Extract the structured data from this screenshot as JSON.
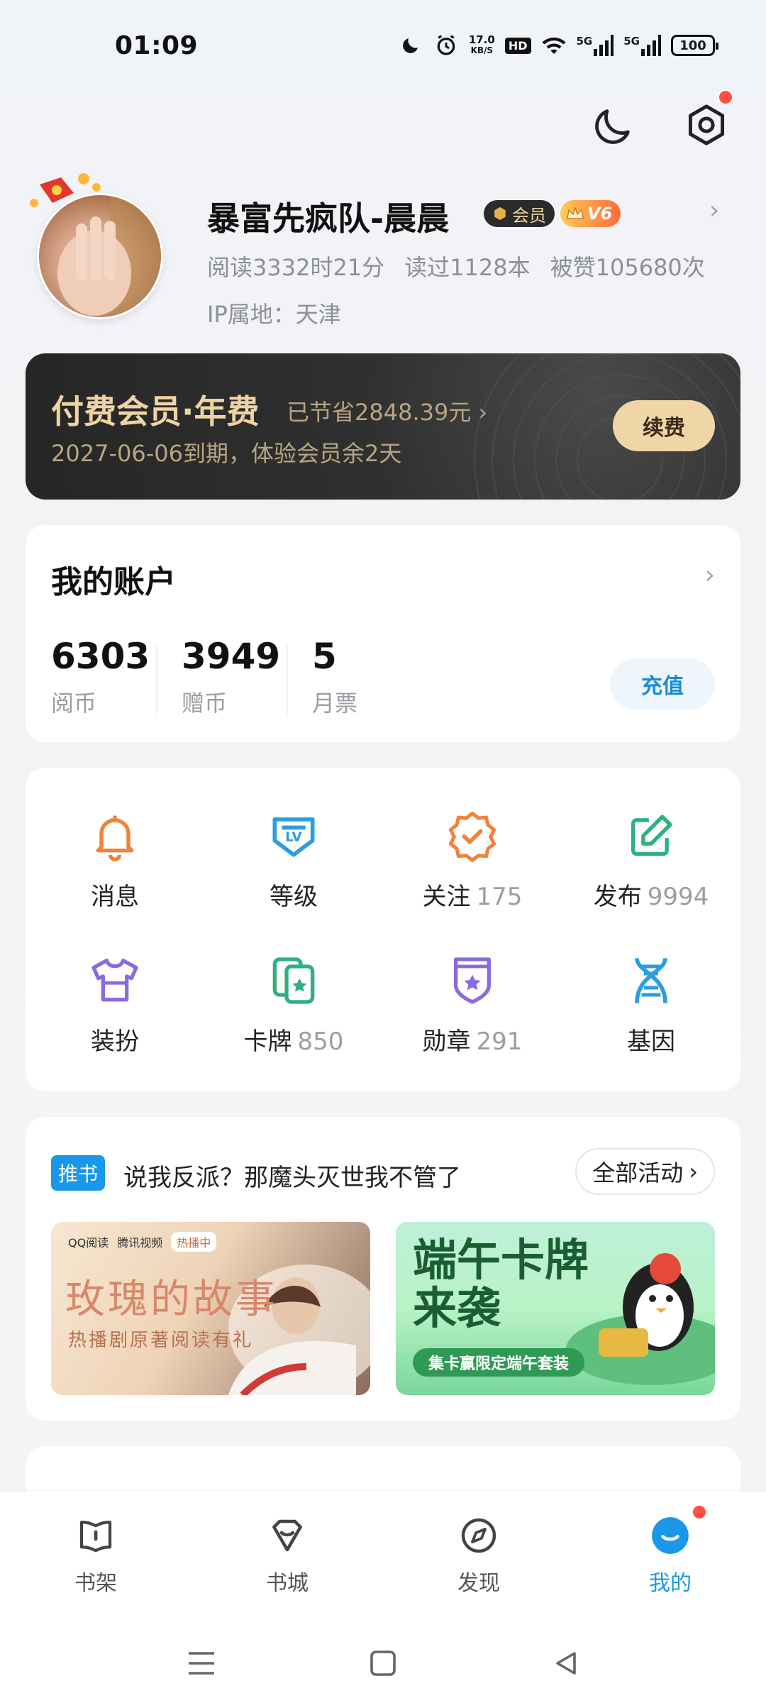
{
  "status_bar": {
    "time": "01:09",
    "net_speed_value": "17.0",
    "net_speed_unit": "KB/S",
    "hd_label": "HD",
    "signal_1": "5G",
    "signal_2": "5G",
    "battery": "100"
  },
  "profile": {
    "username": "暴富先疯队-晨晨",
    "vip_badge": "会员",
    "level_badge": "V6",
    "read_time": "阅读3332时21分",
    "books_read": "读过1128本",
    "likes": "被赞105680次",
    "ip_location": "IP属地：天津"
  },
  "membership": {
    "title": "付费会员·年费",
    "saved": "已节省2848.39元",
    "expiry": "2027-06-06到期，体验会员余2天",
    "renew_label": "续费"
  },
  "account": {
    "title": "我的账户",
    "items": [
      {
        "value": "6303",
        "label": "阅币"
      },
      {
        "value": "3949",
        "label": "赠币"
      },
      {
        "value": "5",
        "label": "月票"
      }
    ],
    "charge_label": "充值"
  },
  "grid": [
    {
      "label": "消息",
      "count": "",
      "icon": "bell-icon"
    },
    {
      "label": "等级",
      "count": "",
      "icon": "level-badge-icon"
    },
    {
      "label": "关注",
      "count": "175",
      "icon": "follow-check-icon"
    },
    {
      "label": "发布",
      "count": "9994",
      "icon": "edit-icon"
    },
    {
      "label": "装扮",
      "count": "",
      "icon": "tshirt-icon"
    },
    {
      "label": "卡牌",
      "count": "850",
      "icon": "cards-icon"
    },
    {
      "label": "勋章",
      "count": "291",
      "icon": "medal-icon"
    },
    {
      "label": "基因",
      "count": "",
      "icon": "dna-icon"
    }
  ],
  "promo": {
    "tag": "推书",
    "text": "说我反派？那魔头灭世我不管了",
    "all_label": "全部活动",
    "banner1": {
      "brand1": "QQ阅读",
      "brand2": "腾讯视频",
      "status": "热播中",
      "title": "玫瑰的故事",
      "subtitle": "热播剧原著阅读有礼"
    },
    "banner2": {
      "title_line1": "端午卡牌",
      "title_line2": "来袭",
      "subtitle": "集卡赢限定端午套装"
    }
  },
  "nav": [
    {
      "label": "书架",
      "icon": "bookshelf-icon",
      "active": false
    },
    {
      "label": "书城",
      "icon": "bookstore-icon",
      "active": false
    },
    {
      "label": "发现",
      "icon": "compass-icon",
      "active": false
    },
    {
      "label": "我的",
      "icon": "profile-icon",
      "active": true
    }
  ],
  "colors": {
    "accent": "#1a97e8",
    "gold": "#f0d3a3",
    "badge_red": "#ff5040"
  }
}
